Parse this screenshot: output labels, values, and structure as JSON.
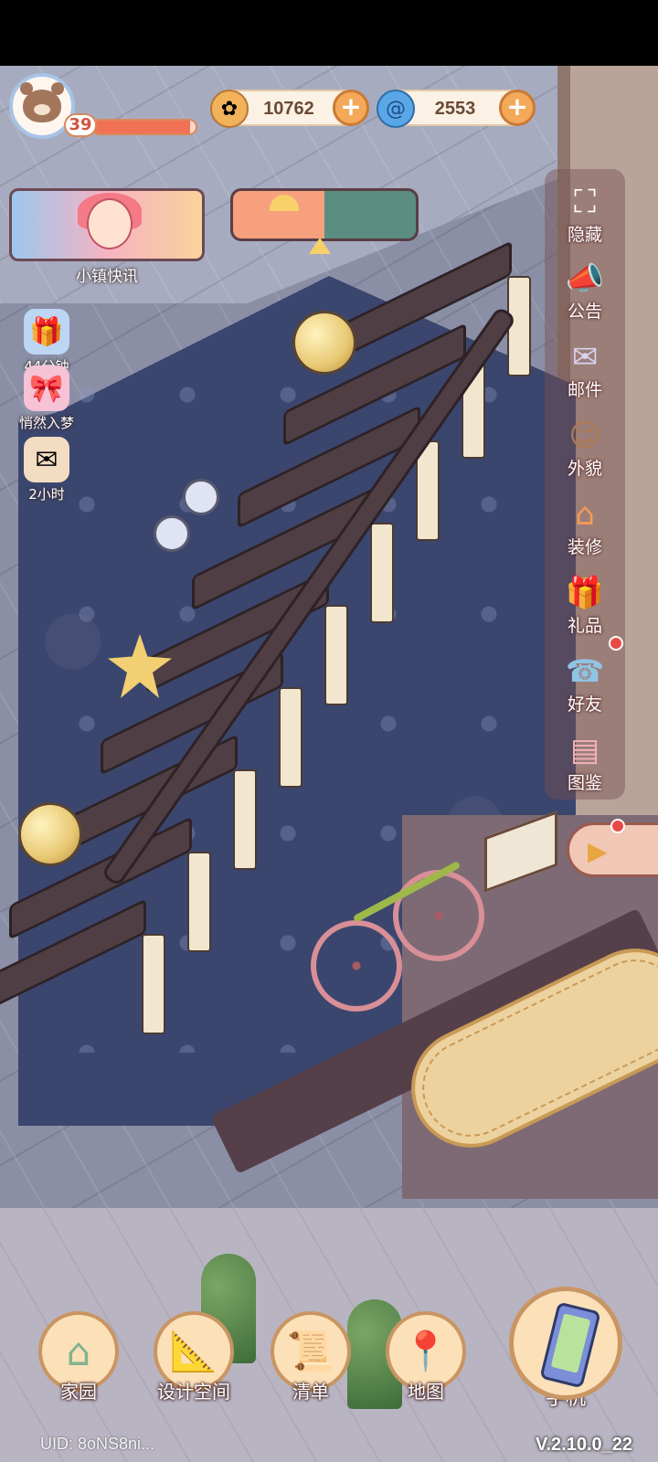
{
  "player": {
    "level": "39",
    "xp_progress": 0.95
  },
  "currencies": [
    {
      "name": "coin",
      "icon": "coin-icon",
      "value": "10762"
    },
    {
      "name": "gem",
      "icon": "swirl-gem-icon",
      "value": "2553"
    }
  ],
  "news": {
    "label": "小镇快讯"
  },
  "timers": [
    {
      "icon": "gift-box-icon",
      "label": "44分钟"
    },
    {
      "icon": "dream-box-icon",
      "label": "悄然入梦"
    },
    {
      "icon": "letter-icon",
      "label": "2小时"
    }
  ],
  "side_menu": [
    {
      "icon": "hide-frame-icon",
      "label": "隐藏"
    },
    {
      "icon": "megaphone-icon",
      "label": "公告"
    },
    {
      "icon": "mail-icon",
      "label": "邮件"
    },
    {
      "icon": "character-icon",
      "label": "外貌"
    },
    {
      "icon": "house-tools-icon",
      "label": "装修"
    },
    {
      "icon": "gift-icon",
      "label": "礼品"
    },
    {
      "icon": "contacts-book-icon",
      "label": "好友"
    },
    {
      "icon": "album-icon",
      "label": "图鉴"
    }
  ],
  "bottom_bar": [
    {
      "icon": "home-icon",
      "label": "家园"
    },
    {
      "icon": "design-ruler-icon",
      "label": "设计空间"
    },
    {
      "icon": "list-scroll-icon",
      "label": "清单"
    },
    {
      "icon": "map-pin-icon",
      "label": "地图"
    }
  ],
  "phone": {
    "label": "手机"
  },
  "footer": {
    "uid": "UID: 8oNS8ni...",
    "version": "V.2.10.0_22"
  },
  "colors": {
    "accent_orange": "#f4a95a",
    "notification_red": "#e84a45",
    "xp_red": "#f07156"
  }
}
